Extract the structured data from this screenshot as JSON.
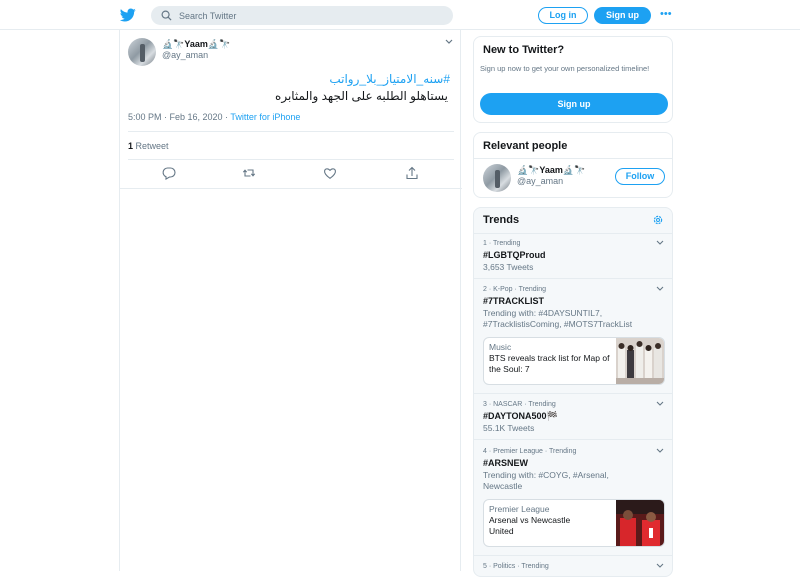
{
  "header": {
    "search_placeholder": "Search Twitter",
    "login_label": "Log in",
    "signup_label": "Sign up",
    "more_label": "•••"
  },
  "tweet": {
    "display_name": "🔬🔭Yaam🔬🔭",
    "handle": "@ay_aman",
    "hashtag": "#سنه_الامتياز_بلا_رواتب",
    "text": "يستاهلو الطلبه على الجهد والمثابره",
    "time": "5:00 PM · Feb 16, 2020 · ",
    "source": "Twitter for iPhone",
    "retweet_count": "1",
    "retweet_label": " Retweet"
  },
  "new_to_twitter": {
    "title": "New to Twitter?",
    "description": "Sign up now to get your own personalized timeline!",
    "signup_label": "Sign up"
  },
  "relevant_people": {
    "title": "Relevant people",
    "name": "🔬🔭Yaam🔬🔭",
    "handle": "@ay_aman",
    "follow_label": "Follow"
  },
  "trends": {
    "title": "Trends",
    "items": [
      {
        "context": "1 · Trending",
        "name": "#LGBTQProud",
        "count": "3,653 Tweets"
      },
      {
        "context": "2 · K-Pop · Trending",
        "name": "#7TRACKLIST",
        "count": "Trending with: #4DAYSUNTIL7, #7TracklistisComing, #MOTS7TrackList",
        "news": {
          "category": "Music",
          "headline": "BTS reveals track list for Map of the Soul: 7"
        }
      },
      {
        "context": "3 · NASCAR · Trending",
        "name": "#DAYTONA500🏁",
        "count": "55.1K Tweets"
      },
      {
        "context": "4 · Premier League · Trending",
        "name": "#ARSNEW",
        "count": "Trending with: #COYG, #Arsenal, Newcastle",
        "news": {
          "category": "Premier League",
          "headline": "Arsenal vs Newcastle United"
        }
      },
      {
        "context": "5 · Politics · Trending"
      }
    ]
  },
  "colors": {
    "accent": "#1da1f2",
    "text": "#14171a",
    "muted": "#657786",
    "border": "#e6ecf0"
  }
}
